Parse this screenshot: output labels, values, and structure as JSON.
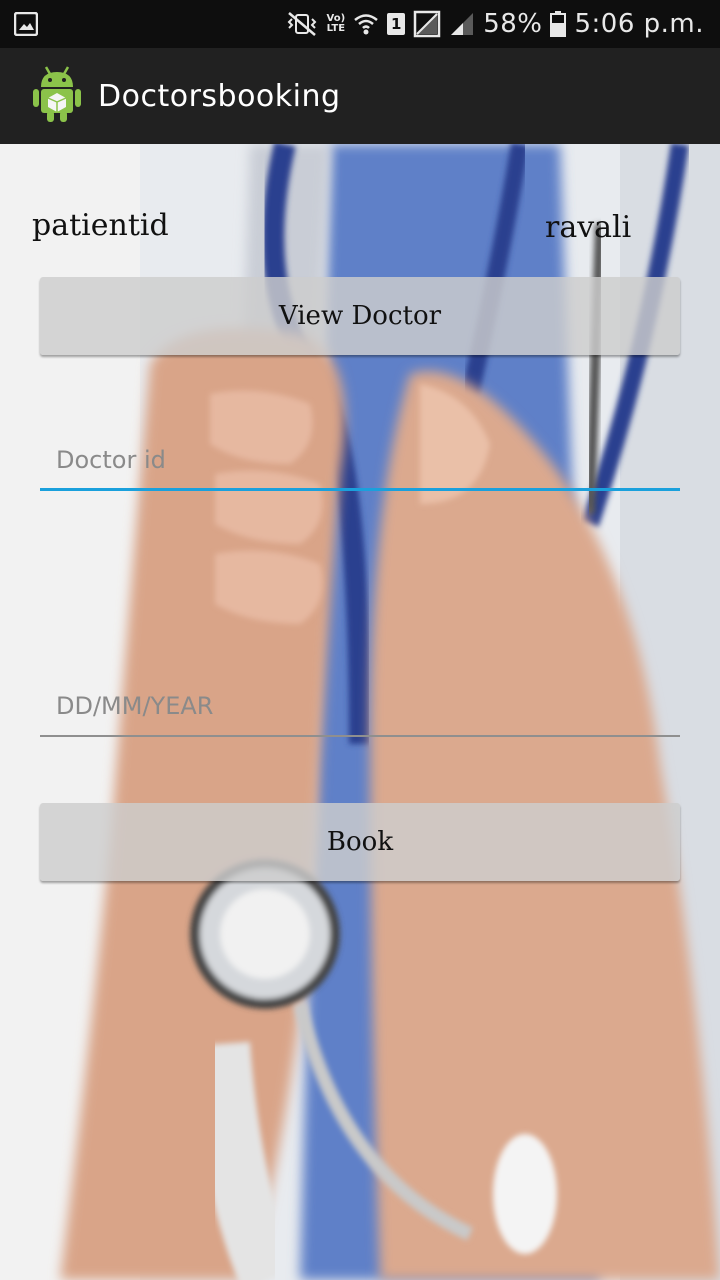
{
  "status_bar": {
    "volte_line1": "Vo)",
    "volte_line2": "LTE",
    "sim_number": "1",
    "battery": "58%",
    "time": "5:06 p.m.",
    "icons": [
      "gallery-icon",
      "mute-vibrate-icon",
      "volte-icon",
      "wifi-icon",
      "sim-1-icon",
      "signal-sim2-icon",
      "signal-sim1-icon",
      "battery-icon"
    ]
  },
  "app_bar": {
    "title": "Doctorsbooking",
    "icon": "android-icon",
    "background": "#212121"
  },
  "form": {
    "patient_label": "patientid",
    "patient_value": "ravali",
    "view_button": "View Doctor",
    "doctor_id_placeholder": "Doctor id",
    "doctor_id_value": "",
    "date_placeholder": "DD/MM/YEAR",
    "date_value": "",
    "book_button": "Book",
    "accent_color": "#1aa0dc"
  }
}
